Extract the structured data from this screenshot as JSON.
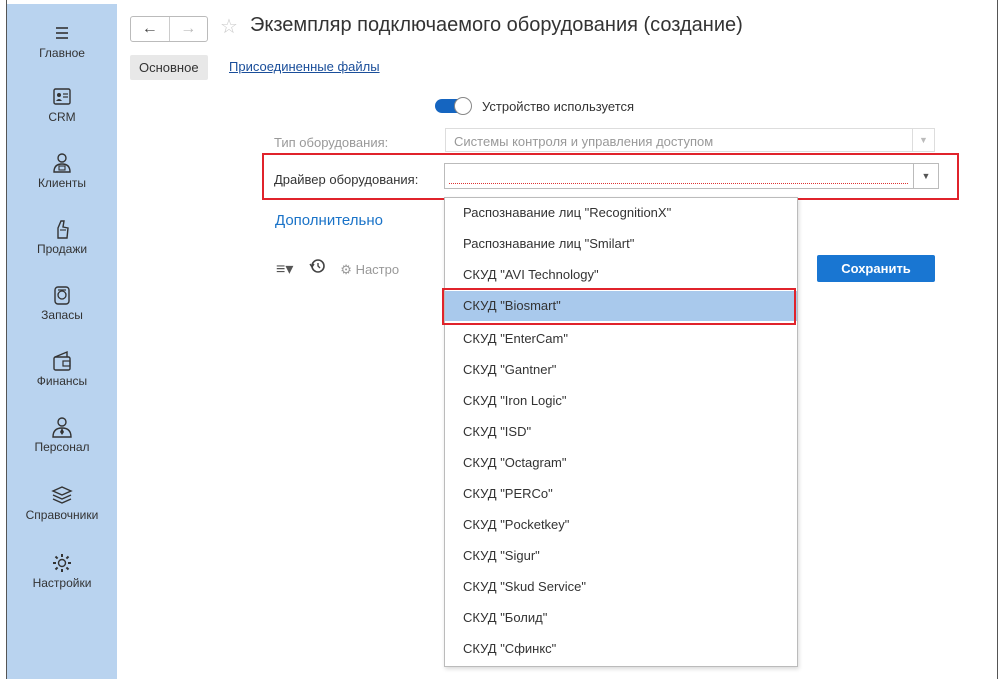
{
  "sidebar": {
    "items": [
      {
        "label": "Главное",
        "icon": "menu-icon"
      },
      {
        "label": "CRM",
        "icon": "contact-card-icon"
      },
      {
        "label": "Клиенты",
        "icon": "clients-icon"
      },
      {
        "label": "Продажи",
        "icon": "sales-icon"
      },
      {
        "label": "Запасы",
        "icon": "stock-icon"
      },
      {
        "label": "Финансы",
        "icon": "wallet-icon"
      },
      {
        "label": "Персонал",
        "icon": "staff-icon"
      },
      {
        "label": "Справочники",
        "icon": "catalogs-icon"
      },
      {
        "label": "Настройки",
        "icon": "settings-icon"
      }
    ]
  },
  "header": {
    "back": "←",
    "forward": "→",
    "star": "☆",
    "title": "Экземпляр подключаемого оборудования (создание)"
  },
  "tabs": {
    "main": "Основное",
    "files": "Присоединенные файлы"
  },
  "form": {
    "toggle_label": "Устройство используется",
    "toggle_on": true,
    "type_label": "Тип оборудования:",
    "type_value": "Системы контроля и управления доступом",
    "driver_label": "Драйвер оборудования:",
    "driver_value": "",
    "more_link": "Дополнительно",
    "settings_label": "Настро",
    "save_button": "Сохранить"
  },
  "dropdown": {
    "options": [
      "Распознавание лиц \"RecognitionX\"",
      "Распознавание лиц \"Smilart\"",
      "СКУД \"AVI Technology\"",
      "СКУД \"Biosmart\"",
      "СКУД \"EnterCam\"",
      "СКУД \"Gantner\"",
      "СКУД \"Iron Logic\"",
      "СКУД \"ISD\"",
      "СКУД \"Octagram\"",
      "СКУД \"PERCo\"",
      "СКУД \"Pocketkey\"",
      "СКУД \"Sigur\"",
      "СКУД \"Skud Service\"",
      "СКУД \"Болид\"",
      "СКУД \"Сфинкс\""
    ],
    "selected": "СКУД \"Biosmart\""
  },
  "colors": {
    "sidebar": "#b9d3ef",
    "accent": "#1976d2",
    "highlight": "#e0232b",
    "selected_option": "#a9c9ec"
  }
}
